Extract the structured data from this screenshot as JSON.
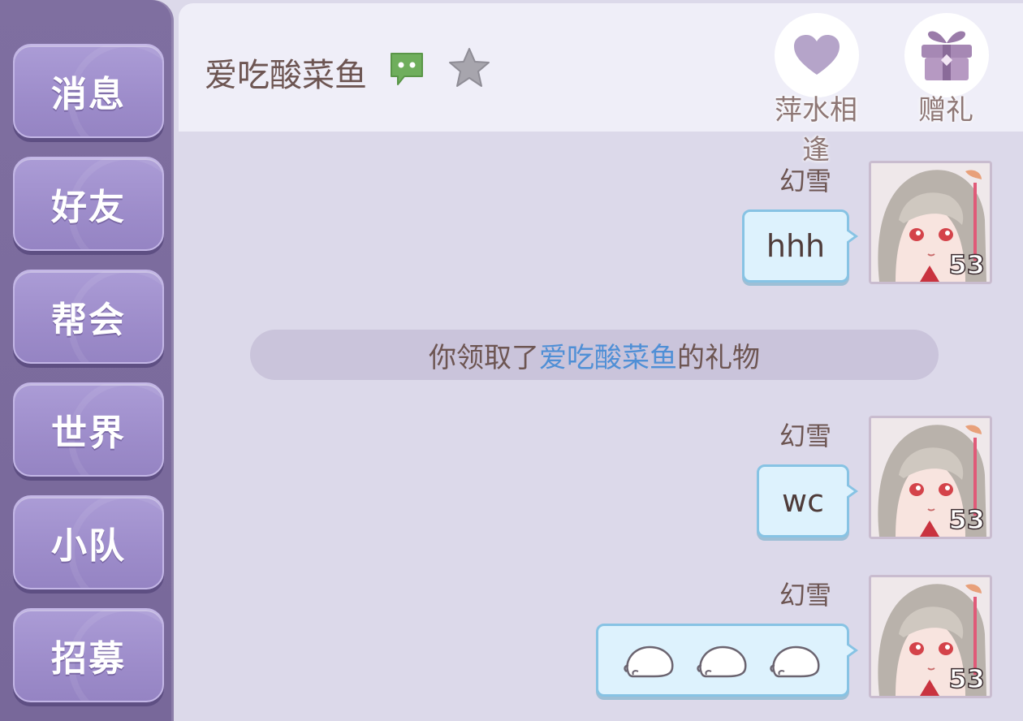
{
  "sidebar": {
    "items": [
      {
        "label": "消息"
      },
      {
        "label": "好友"
      },
      {
        "label": "帮会"
      },
      {
        "label": "世界"
      },
      {
        "label": "小队"
      },
      {
        "label": "招募"
      }
    ]
  },
  "header": {
    "title": "爱吃酸菜鱼",
    "icons": {
      "chat": "chat-bubble-icon",
      "star": "star-icon"
    },
    "actions": [
      {
        "label": "萍水相逢",
        "icon": "heart-icon"
      },
      {
        "label": "赠礼",
        "icon": "gift-icon"
      }
    ]
  },
  "messages": [
    {
      "sender": "幻雪",
      "text": "hhh",
      "level": "53"
    },
    {
      "sender": "幻雪",
      "text": "wc",
      "level": "53"
    },
    {
      "sender": "幻雪",
      "text": "",
      "level": "53",
      "emojis": [
        "sleeping-cat-emoji",
        "sleeping-cat-emoji",
        "sleeping-cat-emoji"
      ]
    }
  ],
  "system": {
    "prefix": "你领取了",
    "highlight": "爱吃酸菜鱼",
    "suffix": "的礼物"
  },
  "colors": {
    "accent_purple": "#9d8cca",
    "bubble_blue": "#ddf2fd",
    "highlight_blue": "#4f8fd6"
  }
}
